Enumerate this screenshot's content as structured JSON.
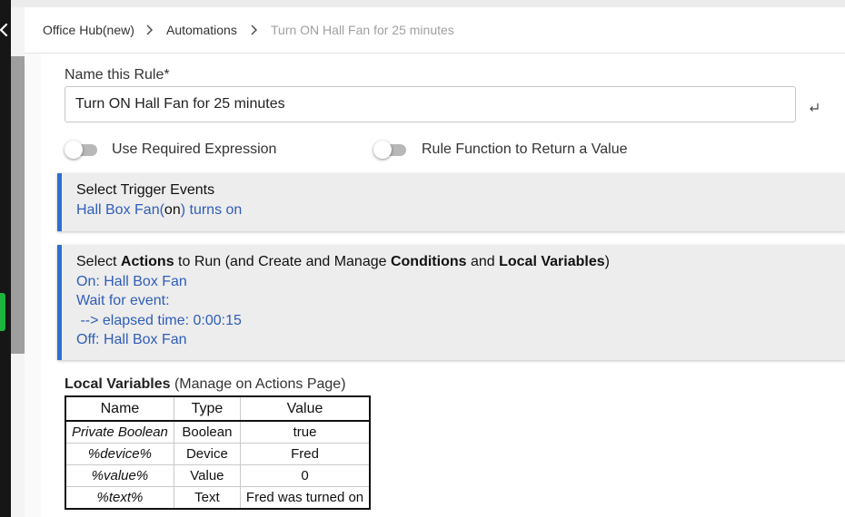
{
  "breadcrumb": {
    "items": [
      "Office Hub(new)",
      "Automations"
    ],
    "current": "Turn ON Hall Fan for 25 minutes"
  },
  "rule": {
    "name_label": "Name this Rule*",
    "name_value": "Turn ON Hall Fan for 25 minutes"
  },
  "toggles": {
    "required_expression": {
      "label": "Use Required Expression",
      "on": false
    },
    "return_value": {
      "label": "Rule Function to Return a Value",
      "on": false
    }
  },
  "triggers": {
    "heading": "Select Trigger Events",
    "device": "Hall Box Fan(",
    "state": "on",
    "suffix": ") turns on"
  },
  "actions": {
    "heading_parts": [
      "Select ",
      "Actions",
      " to Run (and Create and Manage ",
      "Conditions",
      " and ",
      "Local Variables",
      ")"
    ],
    "lines": [
      "On: Hall Box Fan",
      "Wait for event:",
      " --> elapsed time: 0:00:15",
      "Off: Hall Box Fan"
    ]
  },
  "local_variables": {
    "title": "Local Variables",
    "subtitle": " (Manage on Actions Page)",
    "columns": [
      "Name",
      "Type",
      "Value"
    ],
    "rows": [
      [
        "Private Boolean",
        "Boolean",
        "true"
      ],
      [
        "%device%",
        "Device",
        "Fred"
      ],
      [
        "%value%",
        "Value",
        "0"
      ],
      [
        "%text%",
        "Text",
        "Fred was turned on"
      ]
    ]
  },
  "colors": {
    "accent_blue": "#2f6fd1",
    "link_blue": "#2f5db8",
    "panel_bg": "#ededed",
    "status_green": "#1db33f"
  },
  "icons": [
    "back-icon",
    "chevron-right-icon",
    "enter-icon"
  ]
}
